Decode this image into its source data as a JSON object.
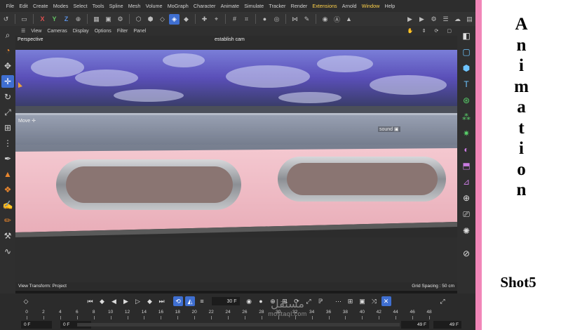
{
  "menu": [
    "File",
    "Edit",
    "Create",
    "Modes",
    "Select",
    "Tools",
    "Spline",
    "Mesh",
    "Volume",
    "MoGraph",
    "Character",
    "Animate",
    "Simulate",
    "Tracker",
    "Render",
    "Extensions",
    "Arnold",
    "Window",
    "Help"
  ],
  "menu_highlight": [
    "Extensions",
    "Window"
  ],
  "toolbar": {
    "axis_x": "X",
    "axis_y": "Y",
    "axis_z": "Z"
  },
  "viewport_menu": [
    "View",
    "Cameras",
    "Display",
    "Options",
    "Filter",
    "Panel"
  ],
  "viewport": {
    "view_name": "Perspective",
    "camera_name": "establish cam",
    "move_label": "Move",
    "object_label": "sound",
    "view_transform": "View Transform: Project",
    "grid_spacing": "Grid Spacing : 50 cm"
  },
  "timeline": {
    "current_frame": "30 F",
    "ruler": [
      "0",
      "2",
      "4",
      "6",
      "8",
      "10",
      "12",
      "14",
      "16",
      "18",
      "20",
      "22",
      "24",
      "26",
      "28",
      "30",
      "32",
      "34",
      "36",
      "38",
      "40",
      "42",
      "44",
      "46",
      "48"
    ],
    "start_field": "0 F",
    "min_field": "0 F",
    "max_field": "49 F",
    "end_field": "49 F"
  },
  "watermark": {
    "brand_glyph": "مستقل",
    "brand_url": "mostaql.com"
  },
  "side_title": {
    "letters": [
      "A",
      "n",
      "i",
      "m",
      "a",
      "t",
      "i",
      "o",
      "n"
    ],
    "shot": "Shot5"
  },
  "colors": {
    "accent": "#3f6fd1",
    "pink": "#f186b8",
    "highlight_menu": "#ffd24a"
  }
}
